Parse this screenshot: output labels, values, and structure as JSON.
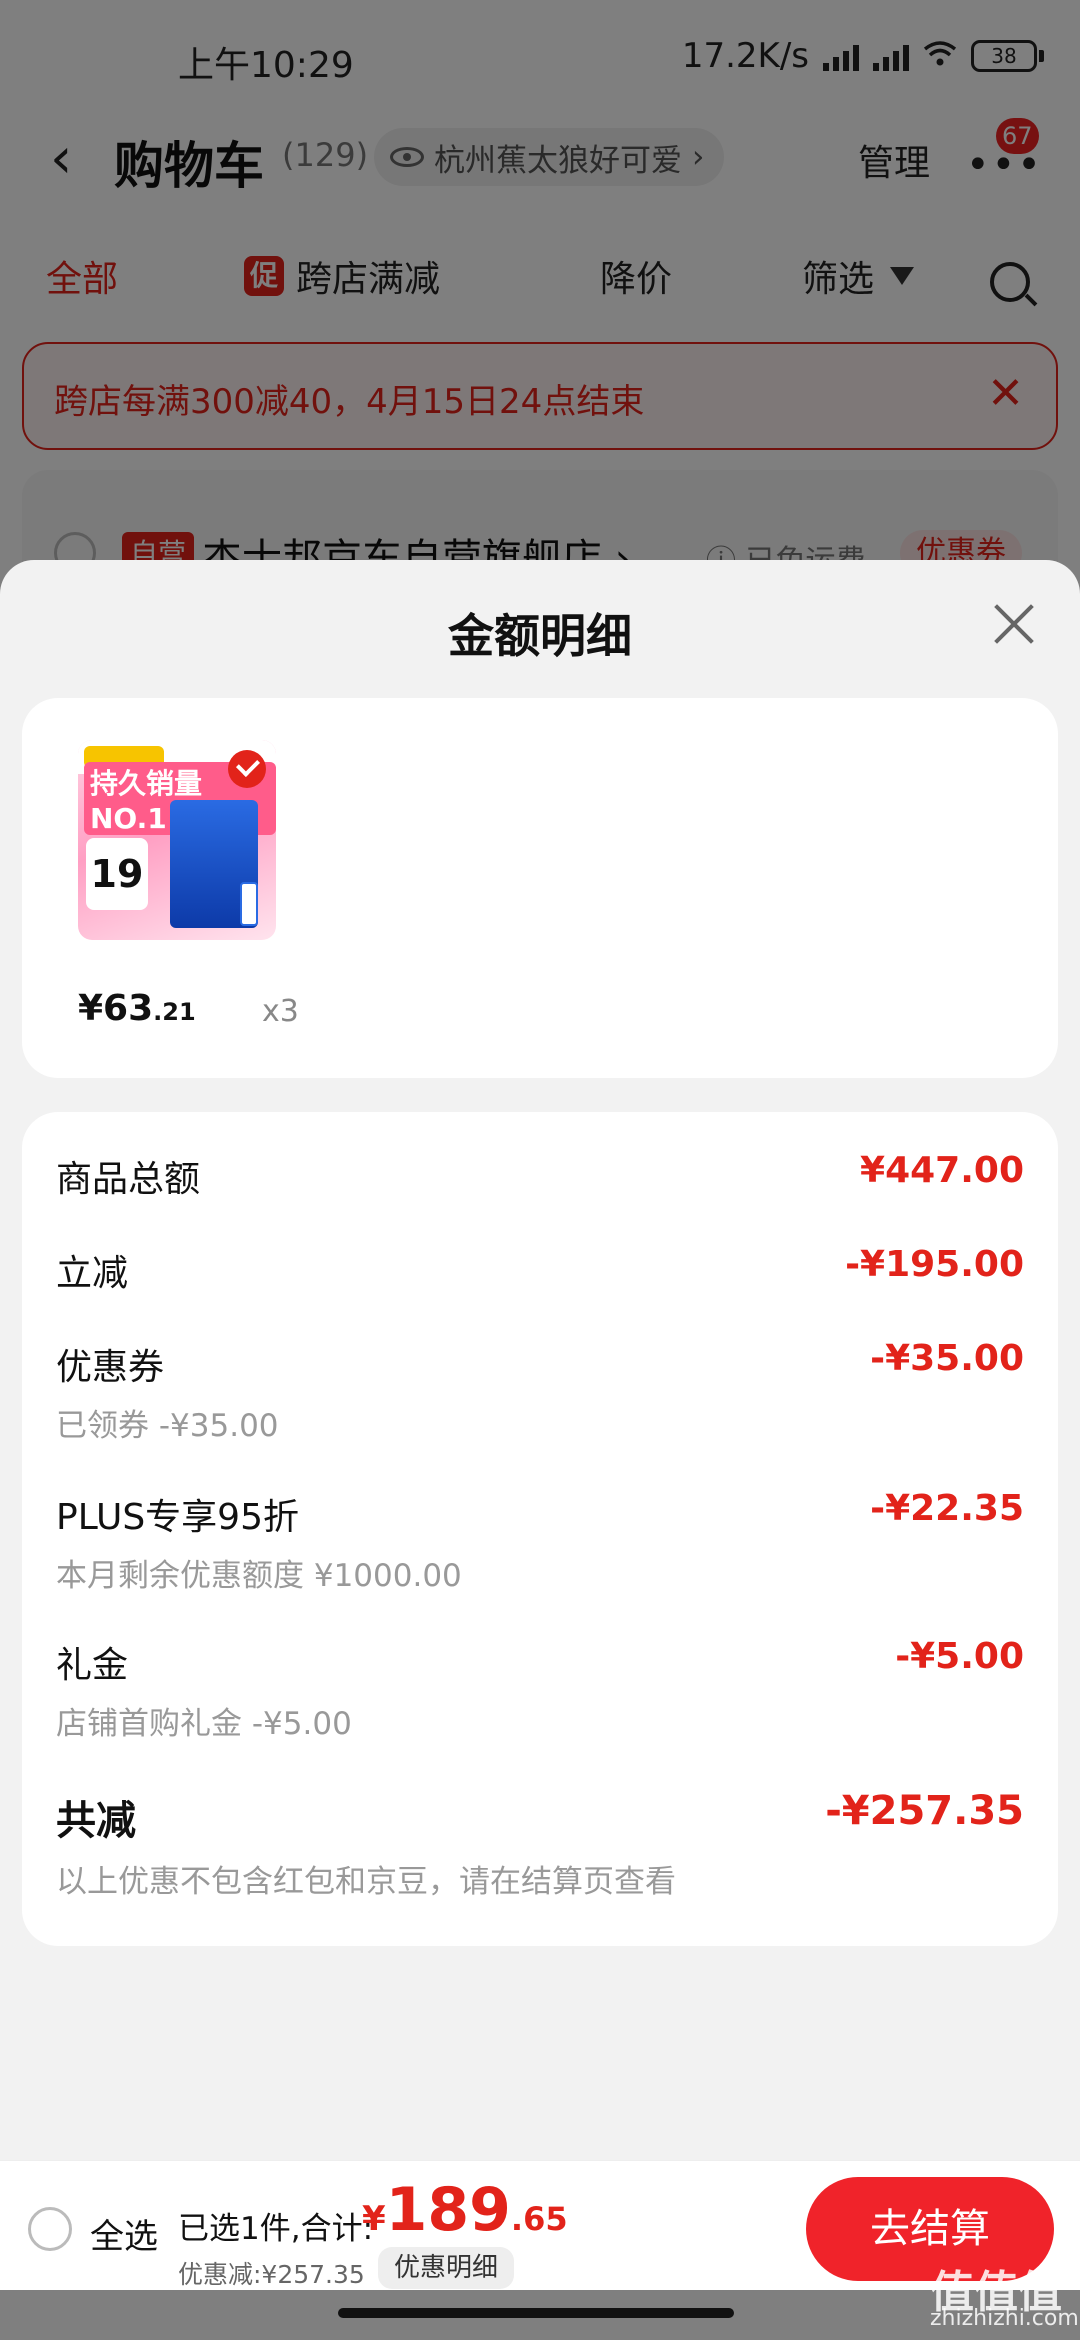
{
  "status_bar": {
    "time": "上午10:29",
    "net_speed": "17.2K/s",
    "battery": "38"
  },
  "nav": {
    "back": "‹",
    "title": "购物车",
    "count": "(129)",
    "location": "杭州蕉太狼好可爱",
    "location_chevron": "›",
    "manage": "管理",
    "more": "•••",
    "badge": "67"
  },
  "tabs": {
    "all": "全部",
    "promo_icon": "促",
    "cross_store": "跨店满减",
    "price_drop": "降价",
    "filter": "筛选"
  },
  "notice": {
    "text": "跨店每满300减40，4月15日24点结束",
    "close": "✕"
  },
  "store": {
    "tag": "自营",
    "name": "杰士邦京东自营旗舰店 ›",
    "shipping": "ⓘ 已免运费",
    "coupon": "优惠券"
  },
  "sheet": {
    "title": "金额明细",
    "product": {
      "thumb_slogan": "持久销量NO.1",
      "thumb_price": "19",
      "price_int": "¥63",
      "price_dec": ".21",
      "qty": "x3"
    },
    "rows": [
      {
        "label": "商品总额",
        "sub": "",
        "amount": "¥447.00"
      },
      {
        "label": "立减",
        "sub": "",
        "amount": "-¥195.00"
      },
      {
        "label": "优惠券",
        "sub": "已领券 -¥35.00",
        "amount": "-¥35.00"
      },
      {
        "label": "PLUS专享95折",
        "sub": "本月剩余优惠额度 ¥1000.00",
        "amount": "-¥22.35"
      },
      {
        "label": "礼金",
        "sub": "店铺首购礼金 -¥5.00",
        "amount": "-¥5.00"
      }
    ],
    "total": {
      "label": "共减",
      "sub": "以上优惠不包含红包和京豆，请在结算页查看",
      "amount": "-¥257.35"
    }
  },
  "bottom": {
    "select_all": "全选",
    "selected": "已选1件,合计:",
    "total_currency": "¥",
    "total_int": "189",
    "total_dec": ".65",
    "saved": "优惠减:¥257.35",
    "detail_button": "优惠明细",
    "checkout": "去结算"
  },
  "watermark": {
    "text": "值值值",
    "sub": "zhizhizhi.com"
  },
  "colors": {
    "accent": "#e2231a",
    "sheet_bg": "#f2f2f2"
  }
}
